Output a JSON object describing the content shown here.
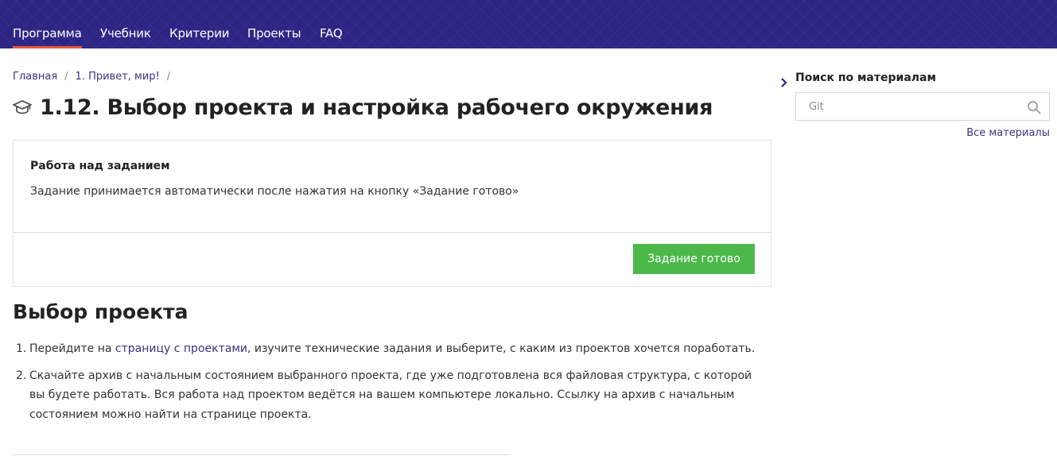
{
  "colors": {
    "header_bg": "#2e2684",
    "active_underline": "#e6553f",
    "link": "#3b3380",
    "button_green": "#4cb84a"
  },
  "nav": {
    "items": [
      {
        "label": "Программа",
        "active": true
      },
      {
        "label": "Учебник",
        "active": false
      },
      {
        "label": "Критерии",
        "active": false
      },
      {
        "label": "Проекты",
        "active": false
      },
      {
        "label": "FAQ",
        "active": false
      }
    ]
  },
  "breadcrumb": {
    "items": [
      "Главная",
      "1. Привет, мир!"
    ],
    "separator": "/"
  },
  "page": {
    "icon": "graduation-cap-icon",
    "title": "1.12. Выбор проекта и настройка рабочего окружения"
  },
  "task": {
    "heading": "Работа над заданием",
    "text": "Задание принимается автоматически после нажатия на кнопку «Задание готово»",
    "button_label": "Задание готово"
  },
  "section": {
    "title": "Выбор проекта",
    "steps": [
      {
        "num": "1.",
        "before": "Перейдите на ",
        "link": "страницу с проектами",
        "after": ", изучите технические задания и выберите, с каким из проектов хочется поработать."
      },
      {
        "num": "2.",
        "line1": "Скачайте архив с начальным состоянием выбранного проекта, где уже подготовлена вся файловая структура, с которой",
        "line2": "вы будете работать. Вся работа над проектом ведётся на вашем компьютере локально. Ссылку на архив с начальным",
        "line3": "состоянием можно найти на странице проекта."
      }
    ]
  },
  "search": {
    "heading": "Поиск по материалам",
    "placeholder": "Git",
    "icon": "search-icon",
    "all_materials_link": "Все материалы"
  }
}
